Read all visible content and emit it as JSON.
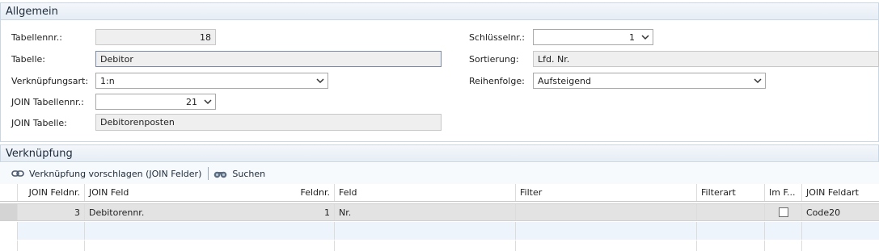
{
  "section_general": {
    "title": "Allgemein",
    "table_no_label": "Tabellennr.:",
    "table_no_value": "18",
    "table_label": "Tabelle:",
    "table_value": "Debitor",
    "link_type_label": "Verknüpfungsart:",
    "link_type_value": "1:n",
    "join_table_no_label": "JOIN Tabellennr.:",
    "join_table_no_value": "21",
    "join_table_label": "JOIN Tabelle:",
    "join_table_value": "Debitorenposten",
    "key_no_label": "Schlüsselnr.:",
    "key_no_value": "1",
    "sorting_label": "Sortierung:",
    "sorting_value": "Lfd. Nr.",
    "order_label": "Reihenfolge:",
    "order_value": "Aufsteigend"
  },
  "section_link": {
    "title": "Verknüpfung",
    "toolbar": {
      "suggest_label": "Verknüpfung vorschlagen (JOIN Felder)",
      "suggest_icon": "link-icon",
      "search_label": "Suchen",
      "search_icon": "binoculars-icon"
    },
    "columns": [
      "JOIN Feldnr.",
      "JOIN Feld",
      "Feldnr.",
      "Feld",
      "Filter",
      "Filterart",
      "Im F...",
      "JOIN Feldart"
    ],
    "rows": [
      {
        "join_field_no": "3",
        "join_field": "Debitorennr.",
        "field_no": "1",
        "field": "Nr.",
        "filter": "",
        "filter_type": "",
        "join_field_type": "Code20"
      }
    ]
  },
  "colors": {
    "header_bg": "#e6edf5",
    "border": "#c9d6e4",
    "selected_row": "#e3e3e3",
    "new_row": "#eef4fb"
  }
}
